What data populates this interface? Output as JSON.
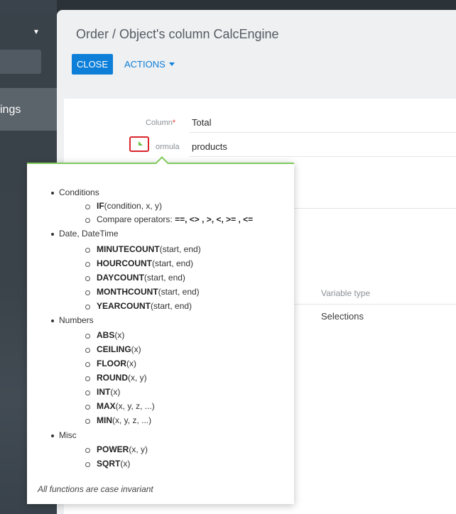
{
  "sidebar": {
    "settings_label": "ings"
  },
  "header": {
    "title": "Order / Object's column CalcEngine",
    "close_label": "CLOSE",
    "actions_label": "ACTIONS"
  },
  "form": {
    "column_label": "Column",
    "column_required": "*",
    "column_value": "Total",
    "formula_label": "ormula",
    "formula_value": "products"
  },
  "variables": {
    "type_header": "Variable type",
    "type_value": "Selections"
  },
  "help": {
    "conditions": "Conditions",
    "if_fn": "IF",
    "if_args": "(condition, x, y)",
    "compare_label": "Compare operators: ",
    "compare_ops": "==, <> , >, <, >= , <=",
    "date_cat": "Date, DateTime",
    "minutecount": "MINUTECOUNT",
    "minutecount_args": "(start, end)",
    "hourcount": "HOURCOUNT",
    "hourcount_args": "(start, end)",
    "daycount": "DAYCOUNT",
    "daycount_args": "(start, end)",
    "monthcount": "MONTHCOUNT",
    "monthcount_args": "(start, end)",
    "yearcount": "YEARCOUNT",
    "yearcount_args": "(start, end)",
    "numbers_cat": "Numbers",
    "abs": "ABS",
    "abs_args": "(x)",
    "ceiling": "CEILING",
    "ceiling_args": "(x)",
    "floor": "FLOOR",
    "floor_args": "(x)",
    "round": "ROUND",
    "round_args": "(x, y)",
    "int": "INT",
    "int_args": "(x)",
    "max": "MAX",
    "max_args": "(x, y, z, ...)",
    "min": "MIN",
    "min_args": "(x, y, z, ...)",
    "misc_cat": "Misc",
    "power": "POWER",
    "power_args": "(x, y)",
    "sqrt": "SQRT",
    "sqrt_args": "(x)",
    "note": "All functions are case invariant"
  },
  "colors": {
    "accent": "#0d7fd8",
    "popover_border": "#7dc95a",
    "highlight": "#d9262c"
  }
}
